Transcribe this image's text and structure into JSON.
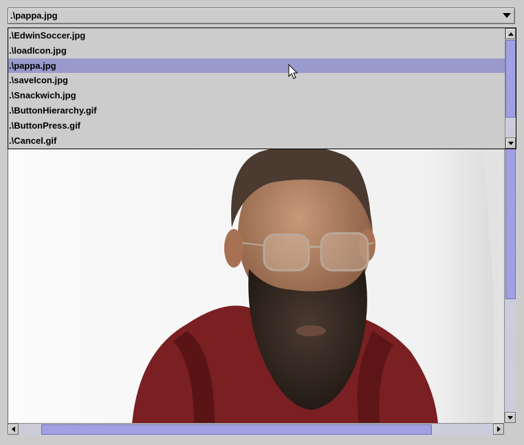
{
  "combo": {
    "selected": ".\\pappa.jpg",
    "arrow_icon": "triangle-down-icon"
  },
  "list": {
    "items": [
      {
        "label": ".\\EdwinSoccer.jpg",
        "selected": false
      },
      {
        "label": ".\\loadIcon.jpg",
        "selected": false
      },
      {
        "label": ".\\pappa.jpg",
        "selected": true
      },
      {
        "label": ".\\saveIcon.jpg",
        "selected": false
      },
      {
        "label": ".\\Snackwich.jpg",
        "selected": false
      },
      {
        "label": ".\\ButtonHierarchy.gif",
        "selected": false
      },
      {
        "label": ".\\ButtonPress.gif",
        "selected": false
      },
      {
        "label": ".\\Cancel.gif",
        "selected": false
      }
    ],
    "scroll_position": 0.1
  },
  "image_panel": {
    "subject": "photo-of-bearded-man-with-glasses",
    "vertical_scroll": 0.3,
    "horizontal_scroll": 0.05
  },
  "colors": {
    "selection": "#9999cc",
    "scroll_thumb": "#9c9ce0",
    "background": "#cccccc"
  }
}
